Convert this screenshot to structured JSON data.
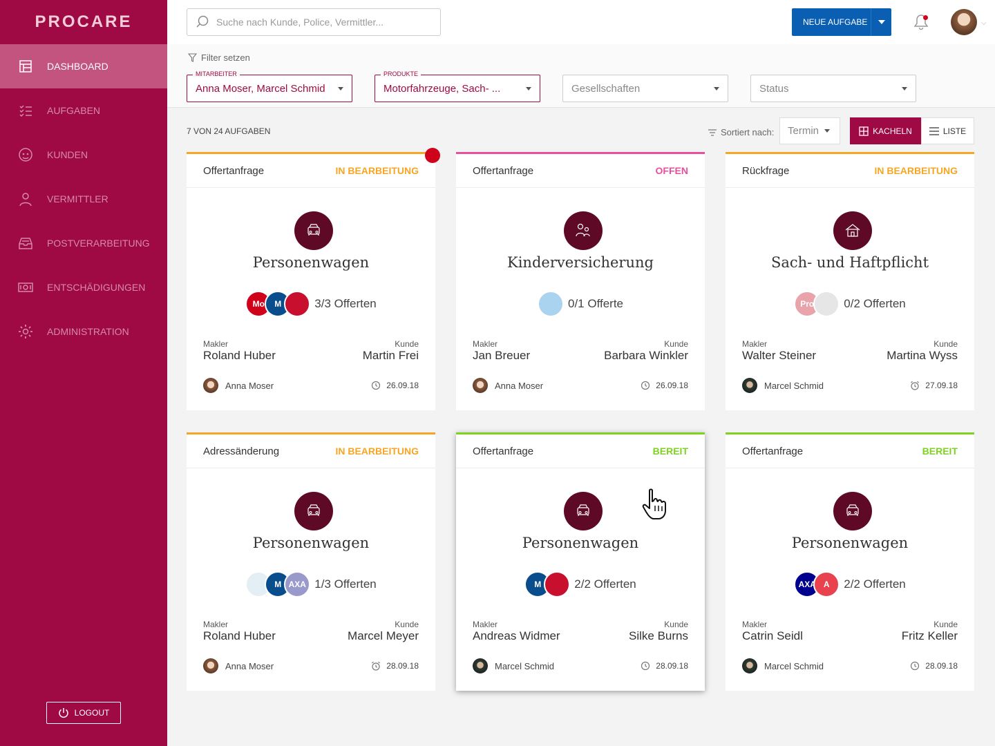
{
  "app": {
    "logo": "PROCARE",
    "sidebar": [
      {
        "label": "DASHBOARD",
        "icon": "dashboard-icon",
        "active": true
      },
      {
        "label": "AUFGABEN",
        "icon": "tasks-icon",
        "active": false
      },
      {
        "label": "KUNDEN",
        "icon": "customers-icon",
        "active": false
      },
      {
        "label": "VERMITTLER",
        "icon": "broker-icon",
        "active": false
      },
      {
        "label": "POSTVERARBEITUNG",
        "icon": "inbox-icon",
        "active": false
      },
      {
        "label": "ENTSCHÄDIGUNGEN",
        "icon": "money-icon",
        "active": false
      },
      {
        "label": "ADMINISTRATION",
        "icon": "gear-icon",
        "active": false
      }
    ],
    "logout_label": "LOGOUT"
  },
  "header": {
    "search_placeholder": "Suche nach Kunde, Police, Vermittler...",
    "new_task_label": "NEUE AUFGABE"
  },
  "filters": {
    "title": "Filter setzen",
    "dropdowns": [
      {
        "label": "MITARBEITER",
        "value": "Anna Moser, Marcel Schmid"
      },
      {
        "label": "PRODUKTE",
        "value": "Motorfahrzeuge, Sach- ..."
      },
      {
        "label": "",
        "value": "Gesellschaften"
      },
      {
        "label": "",
        "value": "Status"
      }
    ]
  },
  "toolbar": {
    "count": "7 VON 24 AUFGABEN",
    "sorted_label": "Sortiert nach:",
    "sort_value": "Termin",
    "view_tiles": "KACHELN",
    "view_list": "LISTE"
  },
  "colors": {
    "brand": "#a00a44",
    "in_progress": "#f5a623",
    "open": "#e94f9c",
    "ready": "#7ed321",
    "primary_button": "#0a5fb3"
  },
  "cards": [
    {
      "type": "Offertanfrage",
      "status": "IN BEARBEITUNG",
      "status_color": "#f5a623",
      "product": "Personenwagen",
      "product_icon": "car-icon",
      "offers": "3/3 Offerten",
      "logos": [
        "#d0021b",
        "#0a4d8c",
        "#c8102e"
      ],
      "logo_text": [
        "Mo",
        "M",
        ""
      ],
      "makler_label": "Makler",
      "makler": "Roland Huber",
      "kunde_label": "Kunde",
      "kunde": "Martin Frei",
      "assignee": "Anna Moser",
      "assignee_avatar": "anna",
      "date": "26.09.18",
      "date_icon": "clock-icon"
    },
    {
      "type": "Offertanfrage",
      "status": "OFFEN",
      "status_color": "#e94f9c",
      "product": "Kinderversicherung",
      "product_icon": "child-icon",
      "offers": "0/1 Offerte",
      "logos": [
        "#a9d3ef"
      ],
      "logo_text": [
        ""
      ],
      "makler_label": "Makler",
      "makler": "Jan Breuer",
      "kunde_label": "Kunde",
      "kunde": "Barbara Winkler",
      "assignee": "Anna Moser",
      "assignee_avatar": "anna",
      "date": "26.09.18",
      "date_icon": "clock-icon"
    },
    {
      "type": "Rückfrage",
      "status": "IN BEARBEITUNG",
      "status_color": "#f5a623",
      "product": "Sach- und Haftpflicht",
      "product_icon": "house-icon",
      "offers": "0/2 Offerten",
      "logos": [
        "#e8a3ab",
        "#e6e6e6"
      ],
      "logo_text": [
        "Pro",
        ""
      ],
      "makler_label": "Makler",
      "makler": "Walter Steiner",
      "kunde_label": "Kunde",
      "kunde": "Martina Wyss",
      "assignee": "Marcel Schmid",
      "assignee_avatar": "marcel",
      "date": "27.09.18",
      "date_icon": "alarm-icon"
    },
    {
      "type": "Adressänderung",
      "status": "IN BEARBEITUNG",
      "status_color": "#f5a623",
      "product": "Personenwagen",
      "product_icon": "car-icon",
      "offers": "1/3 Offerten",
      "logos": [
        "#e3eef5",
        "#0a4d8c",
        "#9999cc"
      ],
      "logo_text": [
        "",
        "M",
        "AXA"
      ],
      "makler_label": "Makler",
      "makler": "Roland Huber",
      "kunde_label": "Kunde",
      "kunde": "Marcel Meyer",
      "assignee": "Anna Moser",
      "assignee_avatar": "anna",
      "date": "28.09.18",
      "date_icon": "alarm-icon"
    },
    {
      "type": "Offertanfrage",
      "status": "BEREIT",
      "status_color": "#7ed321",
      "product": "Personenwagen",
      "product_icon": "car-icon",
      "offers": "2/2 Offerten",
      "logos": [
        "#0a4d8c",
        "#c8102e"
      ],
      "logo_text": [
        "M",
        ""
      ],
      "makler_label": "Makler",
      "makler": "Andreas Widmer",
      "kunde_label": "Kunde",
      "kunde": "Silke Burns",
      "assignee": "Marcel Schmid",
      "assignee_avatar": "marcel",
      "date": "28.09.18",
      "date_icon": "clock-icon"
    },
    {
      "type": "Offertanfrage",
      "status": "BEREIT",
      "status_color": "#7ed321",
      "product": "Personenwagen",
      "product_icon": "car-icon",
      "offers": "2/2 Offerten",
      "logos": [
        "#00008f",
        "#e8424f"
      ],
      "logo_text": [
        "AXA",
        "A"
      ],
      "makler_label": "Makler",
      "makler": "Catrin Seidl",
      "kunde_label": "Kunde",
      "kunde": "Fritz Keller",
      "assignee": "Marcel Schmid",
      "assignee_avatar": "marcel",
      "date": "28.09.18",
      "date_icon": "clock-icon"
    }
  ]
}
